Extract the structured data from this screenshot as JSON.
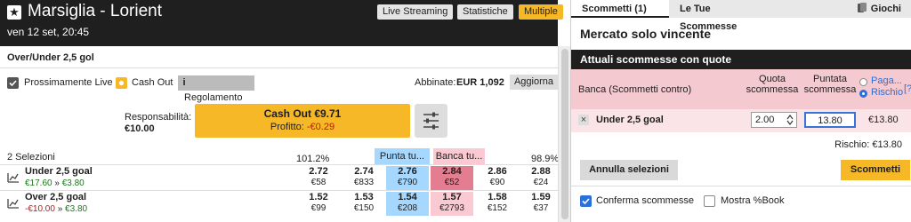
{
  "event": {
    "star_icon": "★",
    "title": "Marsiglia - Lorient",
    "datetime": "ven 12 set, 20:45",
    "buttons": [
      "Live Streaming",
      "Statistiche",
      "Multiple"
    ]
  },
  "market": {
    "name": "Over/Under 2,5 gol",
    "live_label": "Prossimamente Live",
    "cashout_label": "Cash Out",
    "info_icon": "i",
    "rules_label": "Regolamento",
    "matched_label": "Abbinate:",
    "matched_value": "EUR 1,092",
    "refresh_label": "Aggiorna",
    "liability_label": "Responsabilità:",
    "liability_value": "€10.00",
    "cashout_button": "Cash Out €9.71",
    "profit_label": "Profitto:",
    "profit_value": "-€0.29",
    "selections_label": "2 Selezioni",
    "back_pct": "101.2%",
    "lay_pct": "98.9%",
    "back_header": "Punta tu...",
    "lay_header": "Banca tu...",
    "runners": [
      {
        "name": "Under 2,5 goal",
        "pl_now": "€17.60",
        "arrow": "»",
        "pl_after": "€3.80",
        "pl_now_color": "green",
        "cells": [
          {
            "price": "2.72",
            "size": "€58"
          },
          {
            "price": "2.74",
            "size": "€833"
          },
          {
            "price": "2.76",
            "size": "€790"
          },
          {
            "price": "2.84",
            "size": "€52"
          },
          {
            "price": "2.86",
            "size": "€90"
          },
          {
            "price": "2.88",
            "size": "€24"
          }
        ]
      },
      {
        "name": "Over 2,5 goal",
        "pl_now": "-€10.00",
        "arrow": "»",
        "pl_after": "€3.80",
        "pl_now_color": "red",
        "cells": [
          {
            "price": "1.52",
            "size": "€99"
          },
          {
            "price": "1.53",
            "size": "€150"
          },
          {
            "price": "1.54",
            "size": "€208"
          },
          {
            "price": "1.57",
            "size": "€2793"
          },
          {
            "price": "1.58",
            "size": "€152"
          },
          {
            "price": "1.59",
            "size": "€37"
          }
        ]
      }
    ]
  },
  "betslip": {
    "tab_bets": "Scommetti (1)",
    "tab_mybets": "Le Tue Scommesse",
    "tab_games": "Giochi",
    "market_type": "Mercato solo vincente",
    "header": "Attuali scommesse con quote",
    "lay_bets_label": "Banca (Scommetti contro)",
    "odds_col": "Quota scommessa",
    "stake_col": "Puntata scommessa",
    "radio_pay": "Paga...",
    "radio_risk": "Rischio",
    "help": "[?]",
    "bet": {
      "remove_icon": "×",
      "name": "Under 2,5 goal",
      "odds": "2.00",
      "stake": "13.80",
      "liability": "€13.80"
    },
    "total_risk": "Rischio: €13.80",
    "cancel_button": "Annulla selezioni",
    "place_button": "Scommetti",
    "confirm_label": "Conferma scommesse",
    "showbook_label": "Mostra %Book"
  },
  "colors": {
    "header_bg": "#1f1f1f",
    "accent": "#f6b826",
    "back": "#a6d8ff",
    "lay": "#fac9d1",
    "lay_dark": "#e57d90",
    "positive": "#1a7a1a",
    "negative": "#c01818"
  }
}
